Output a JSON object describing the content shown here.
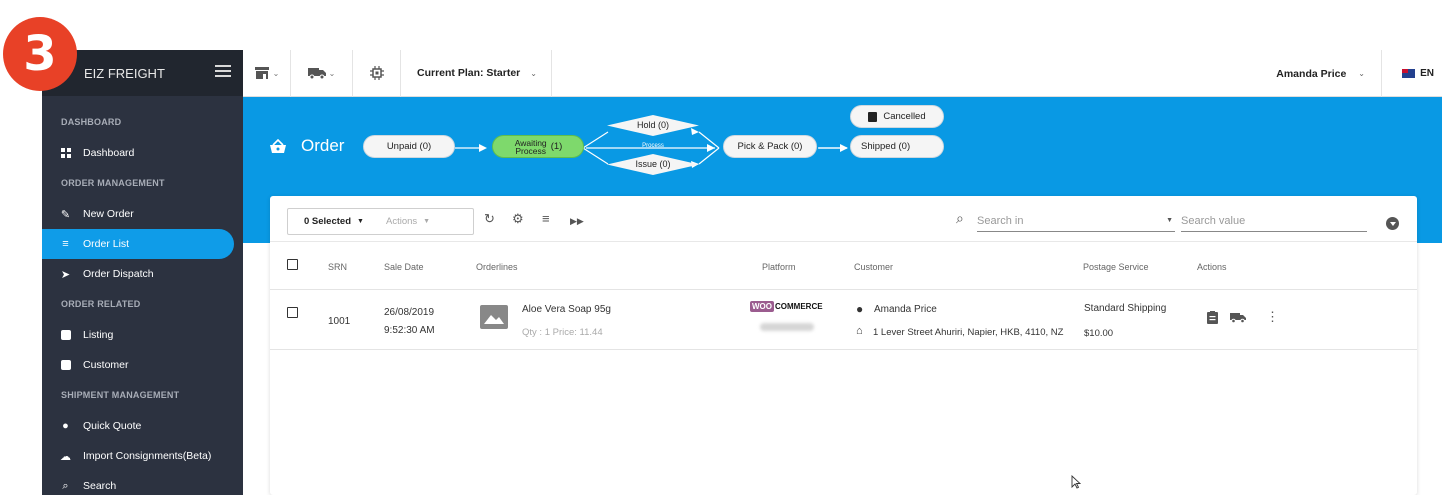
{
  "step_badge": "3",
  "sidebar": {
    "brand": "EIZ FREIGHT",
    "sections": {
      "dashboard": "DASHBOARD",
      "order_management": "ORDER MANAGEMENT",
      "order_related": "ORDER RELATED",
      "shipment_management": "SHIPMENT MANAGEMENT"
    },
    "items": {
      "dashboard": "Dashboard",
      "new_order": "New Order",
      "order_list": "Order List",
      "order_dispatch": "Order Dispatch",
      "listing": "Listing",
      "customer": "Customer",
      "quick_quote": "Quick Quote",
      "import_consignments": "Import Consignments(Beta)",
      "search": "Search"
    }
  },
  "topbar": {
    "plan": "Current Plan: Starter",
    "user": "Amanda Price",
    "language": "EN"
  },
  "banner": {
    "title": "Order",
    "stages": {
      "unpaid": "Unpaid (0)",
      "awaiting": "Awaiting Process",
      "awaiting_count": "(1)",
      "hold": "Hold (0)",
      "process": "Process",
      "issue": "Issue (0)",
      "pick_pack": "Pick & Pack (0)",
      "shipped": "Shipped (0)",
      "cancelled": "Cancelled"
    }
  },
  "toolbar": {
    "selected": "0 Selected",
    "actions": "Actions",
    "search_in": "Search in",
    "search_value": "Search value"
  },
  "table": {
    "headers": {
      "srn": "SRN",
      "sale_date": "Sale Date",
      "orderlines": "Orderlines",
      "platform": "Platform",
      "customer": "Customer",
      "postage": "Postage Service",
      "actions": "Actions"
    },
    "rows": [
      {
        "srn": "1001",
        "date": "26/08/2019",
        "time": "9:52:30 AM",
        "product": "Aloe Vera Soap 95g",
        "qty_price": "Qty : 1 Price: 11.44",
        "platform_woo": "WOO",
        "platform_commerce": "COMMERCE",
        "customer_name": "Amanda Price",
        "customer_address": "1 Lever Street Ahuriri, Napier, HKB, 4110, NZ",
        "postage_service": "Standard Shipping",
        "postage_price": "$10.00"
      }
    ]
  }
}
